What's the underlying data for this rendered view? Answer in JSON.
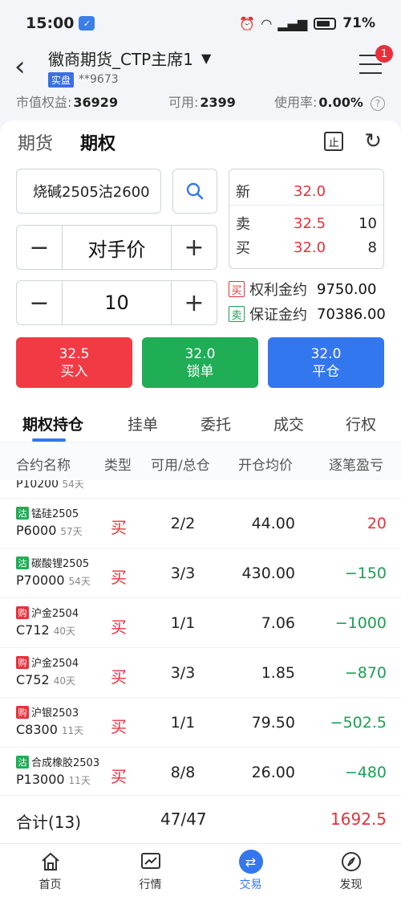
{
  "status_bar": {
    "time": "15:00",
    "battery": "71%"
  },
  "header": {
    "title": "徽商期货_CTP主席1",
    "account_tag": "实盘",
    "account_no": "**9673",
    "badge": "1"
  },
  "account": {
    "equity_label": "市值权益:",
    "equity_value": "36929",
    "available_label": "可用:",
    "available_value": "2399",
    "usage_label": "使用率:",
    "usage_value": "0.00%"
  },
  "top_tabs": [
    "期货",
    "期权"
  ],
  "order": {
    "contract": "烧碱2505沽2600",
    "price_mode": "对手价",
    "quantity": "10",
    "price_minus": "−",
    "price_plus": "+",
    "qty_minus": "−",
    "qty_plus": "+"
  },
  "quote": {
    "new_label": "新",
    "new_price": "32.0",
    "sell_label": "卖",
    "sell_price": "32.5",
    "sell_vol": "10",
    "buy_label": "买",
    "buy_price": "32.0",
    "buy_vol": "8"
  },
  "money": {
    "premium_tag": "买",
    "premium_label": "权利金约",
    "premium_value": "9750.00",
    "margin_tag": "卖",
    "margin_label": "保证金约",
    "margin_value": "70386.00"
  },
  "actions": {
    "buy_price": "32.5",
    "buy_label": "买入",
    "lock_price": "32.0",
    "lock_label": "锁单",
    "close_price": "32.0",
    "close_label": "平仓"
  },
  "mid_tabs": [
    "期权持仓",
    "挂单",
    "委托",
    "成交",
    "行权"
  ],
  "table_headers": [
    "合约名称",
    "类型",
    "可用/总仓",
    "开仓均价",
    "逐笔盈亏"
  ],
  "partial_row": {
    "contract": "P10200",
    "days": "54天"
  },
  "positions": [
    {
      "tag": "沽",
      "name": "锰硅2505",
      "strike": "P6000",
      "days": "57天",
      "type": "买",
      "avail": "2/2",
      "avg": "44.00",
      "pnl": "20"
    },
    {
      "tag": "沽",
      "name": "碳酸锂2505",
      "strike": "P70000",
      "days": "54天",
      "type": "买",
      "avail": "3/3",
      "avg": "430.00",
      "pnl": "−150"
    },
    {
      "tag": "购",
      "name": "沪金2504",
      "strike": "C712",
      "days": "40天",
      "type": "买",
      "avail": "1/1",
      "avg": "7.06",
      "pnl": "−1000"
    },
    {
      "tag": "购",
      "name": "沪金2504",
      "strike": "C752",
      "days": "40天",
      "type": "买",
      "avail": "3/3",
      "avg": "1.85",
      "pnl": "−870"
    },
    {
      "tag": "购",
      "name": "沪银2503",
      "strike": "C8300",
      "days": "11天",
      "type": "买",
      "avail": "1/1",
      "avg": "79.50",
      "pnl": "−502.5"
    },
    {
      "tag": "沽",
      "name": "合成橡胶2503",
      "strike": "P13000",
      "days": "11天",
      "type": "买",
      "avail": "8/8",
      "avg": "26.00",
      "pnl": "−480"
    }
  ],
  "total": {
    "label": "合计(13)",
    "avail": "47/47",
    "pnl": "1692.5"
  },
  "bottom_nav": [
    "首页",
    "行情",
    "交易",
    "发现"
  ],
  "colors": {
    "red": "#e8303a",
    "green": "#1aa053",
    "blue": "#3377ee"
  }
}
